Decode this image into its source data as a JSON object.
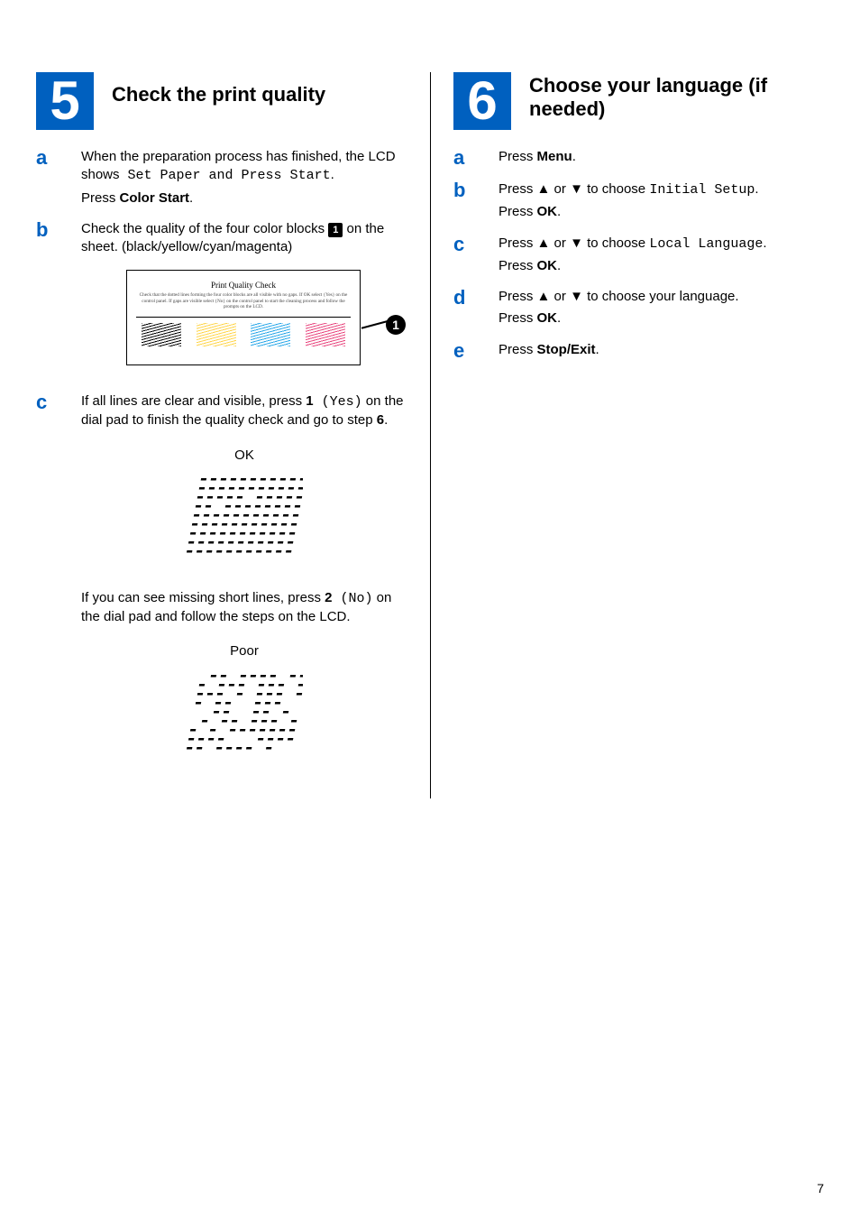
{
  "page_number": "7",
  "section5": {
    "number": "5",
    "title": "Check the print quality",
    "a": {
      "letter": "a",
      "text1_pre": "When the preparation process has finished, the LCD shows",
      "lcd": " Set Paper and Press Start",
      "text1_post": ".",
      "text2_pre": "Press ",
      "button": "Color Start",
      "text2_post": "."
    },
    "b": {
      "letter": "b",
      "text_pre": "Check the quality of the four color blocks ",
      "callout": "1",
      "text_post": " on the sheet. (black/yellow/cyan/magenta)",
      "sheet": {
        "title": "Print Quality Check",
        "sub": "Check that the dotted lines forming the four color blocks are all visible with no gaps. If OK select {Yes} on the control panel. If gaps are visible select {No} on the control panel to start the cleaning process and follow the prompts on the LCD."
      },
      "callout_label": "1"
    },
    "c": {
      "letter": "c",
      "line1_pre": "If all lines are clear and visible, press ",
      "key1": "1",
      "yes": " (Yes)",
      "line1_mid": " on the dial pad to finish the quality check and go to step",
      "step6": " 6",
      "line1_post": ".",
      "label_ok": "OK",
      "line2_pre": "If you can see missing short lines, press ",
      "key2": "2",
      "no": " (No)",
      "line2_post": " on the dial pad and follow the steps on the LCD.",
      "label_poor": "Poor"
    }
  },
  "section6": {
    "number": "6",
    "title": "Choose your language (if needed)",
    "a": {
      "letter": "a",
      "pre": "Press ",
      "bold": "Menu",
      "post": "."
    },
    "b": {
      "letter": "b",
      "pre1": "Press ",
      "pre2": " or ",
      "pre3": " to choose ",
      "mono": "Initial Setup",
      "post1": ".",
      "line2_pre": "Press ",
      "line2_bold": "OK",
      "line2_post": "."
    },
    "c": {
      "letter": "c",
      "pre1": "Press ",
      "pre2": " or ",
      "pre3": " to choose ",
      "mono": "Local Language",
      "post1": ".",
      "line2_pre": "Press ",
      "line2_bold": "OK",
      "line2_post": "."
    },
    "d": {
      "letter": "d",
      "pre1": "Press ",
      "pre2": " or ",
      "pre3": " to choose your language.",
      "line2_pre": "Press ",
      "line2_bold": "OK",
      "line2_post": "."
    },
    "e": {
      "letter": "e",
      "pre": "Press ",
      "bold": "Stop/Exit",
      "post": "."
    }
  },
  "glyphs": {
    "up": "a",
    "down": "b"
  }
}
